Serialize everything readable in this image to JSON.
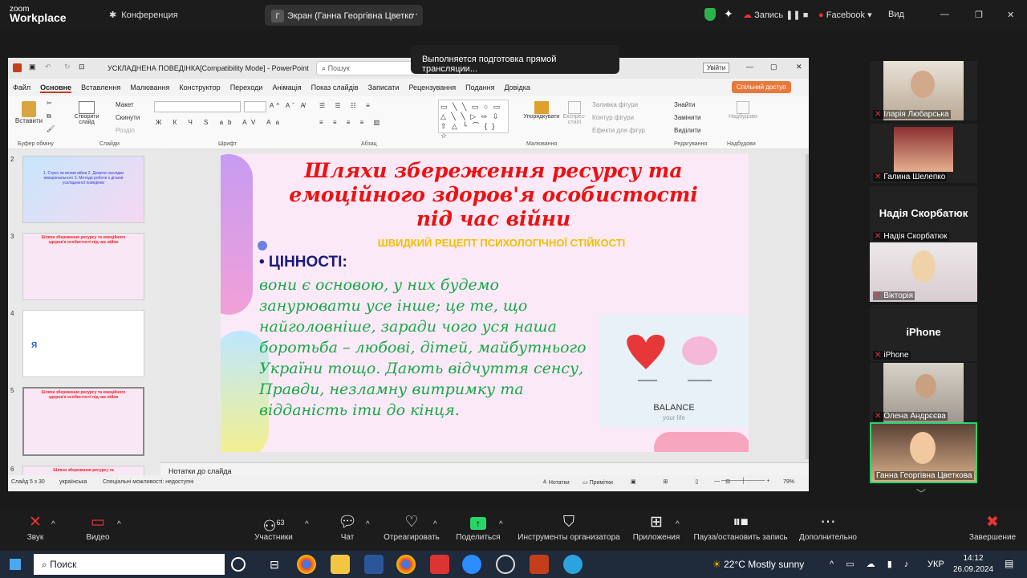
{
  "zoom": {
    "logo_top": "zoom",
    "logo_bottom": "Workplace",
    "conference": "Конференция",
    "screen_letter": "Г",
    "screen_label": "Экран (Ганна Георгівна Цветко",
    "record_label": "Запись",
    "facebook_label": "Facebook",
    "view_label": "Вид",
    "live_notice": "Выполняется подготовка прямой трансляции...",
    "signin": "Увійти"
  },
  "ppt": {
    "title": "УСКЛАДНЕНА ПОВЕДІНКА[Compatibility Mode] - PowerPoint",
    "search": "Пошук",
    "share_btn": "Спільний доступ",
    "menu": [
      "Файл",
      "Основне",
      "Вставлення",
      "Малювання",
      "Конструктор",
      "Переходи",
      "Анімація",
      "Показ слайдів",
      "Записати",
      "Рецензування",
      "Подання",
      "Довідка"
    ],
    "ribbon": {
      "insert": "Вставити",
      "create_slide": "Створити слайд",
      "layout": "Макет",
      "reset": "Скинути",
      "section": "Розділ",
      "arrange": "Упорядкувати",
      "express": "Експрес-стилі",
      "fill": "Заливка фігури",
      "outline": "Контур фігури",
      "effects": "Ефекти для фігур",
      "find": "Знайти",
      "replace": "Замінити",
      "select": "Виділити",
      "groups": [
        "Буфер обміну",
        "Слайди",
        "Шрифт",
        "Абзац",
        "Малювання",
        "Редагування",
        "Надбудови"
      ],
      "addins": "Надбудови"
    },
    "thumbs": [
      {
        "num": "2",
        "text": "1. Стрес як вплив війни 2. Дожити наслідки емоціонального 3. Методи роботи з дітьми ускладненої поведінки"
      },
      {
        "num": "3",
        "text": "Шляхи збереження ресурсу та емоційного здоров'я особистості під час війни"
      },
      {
        "num": "4",
        "text": "Я"
      },
      {
        "num": "5",
        "text": "Шляхи збереження ресурсу та емоційного здоров'я особистості під час війни"
      },
      {
        "num": "6",
        "text": "Шляхи збереження ресурсу та"
      }
    ],
    "slide": {
      "title": "Шляхи збереження ресурсу та емоційного здоров'я особистості під час війни",
      "subtitle": "ШВИДКИЙ РЕЦЕПТ ПСИХОЛОГІЧНОЇ СТІЙКОСТІ",
      "bullet": "• ЦІННОСТІ:",
      "body_lines": [
        "вони є основою, у них будемо",
        "занурювати усе інше; це те, що",
        "найголовніше, заради чого уся наша",
        "боротьба – любові, дітей, майбутнього",
        "України тощо. Дають відчуття сенсу,",
        "Правди, незламну витримку та",
        "відданість іти до кінця."
      ],
      "balance": "BALANCE",
      "yourlife": "your life"
    },
    "notes": "Нотатки до слайда",
    "status": {
      "slide": "Слайд 5 з 30",
      "lang": "українська",
      "access": "Спеціальні можливості: недоступні",
      "notes": "Нотатки",
      "comments": "Примітки",
      "zoom": "79%"
    }
  },
  "participants": [
    {
      "name": "Іларія Любарська",
      "kind": "video"
    },
    {
      "name": "Галина Шелепко",
      "kind": "video"
    },
    {
      "name": "Надія Скорбатюк",
      "kind": "text",
      "big": "Надія Скорбатюк"
    },
    {
      "name": "Вікторія",
      "kind": "video"
    },
    {
      "name": "iPhone",
      "kind": "text",
      "big": "iPhone"
    },
    {
      "name": "Олена Андрєєва",
      "kind": "video"
    },
    {
      "name": "Ганна Георгівна Цветкова",
      "kind": "video"
    }
  ],
  "toolbar": {
    "mute": "Звук",
    "video": "Видео",
    "participants": "Участники",
    "participants_count": "63",
    "chat": "Чат",
    "react": "Отреагировать",
    "share": "Поделиться",
    "host": "Инструменты организатора",
    "apps": "Приложения",
    "pause": "Пауза/остановить запись",
    "more": "Дополнительно",
    "end": "Завершение"
  },
  "taskbar": {
    "search": "Поиск",
    "weather": "22°C  Mostly sunny",
    "lang": "УКР",
    "time": "14:12",
    "date": "26.09.2024"
  }
}
